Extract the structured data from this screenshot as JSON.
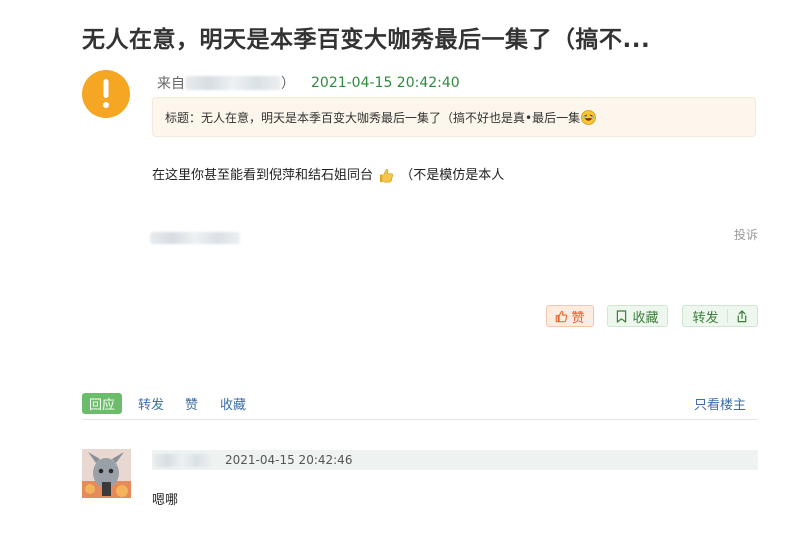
{
  "post": {
    "title": "无人在意，明天是本季百变大咖秀最后一集了（搞不...",
    "from_label": "来自",
    "from_suffix": "）",
    "date": "2021-04-15 20:42:40",
    "topic_text": "标题：无人在意，明天是本季百变大咖秀最后一集了（搞不好也是真•最后一集",
    "body_text": "在这里你甚至能看到倪萍和结石姐同台",
    "body_suffix": "（不是模仿是本人",
    "complain": "投诉"
  },
  "buttons": {
    "like": "赞",
    "favorite": "收藏",
    "share": "转发"
  },
  "actionbar": {
    "reply": "回应",
    "forward": "转发",
    "like": "赞",
    "favorite": "收藏",
    "only_op": "只看楼主"
  },
  "reply": {
    "date": "2021-04-15 20:42:46",
    "text": "嗯哪"
  },
  "colors": {
    "warn_avatar": "#f5a623",
    "date_green": "#2e8b3e",
    "link_blue": "#3d6ea5",
    "reply_tag_bg": "#6bbd6b",
    "like_orange": "#e2632c"
  }
}
